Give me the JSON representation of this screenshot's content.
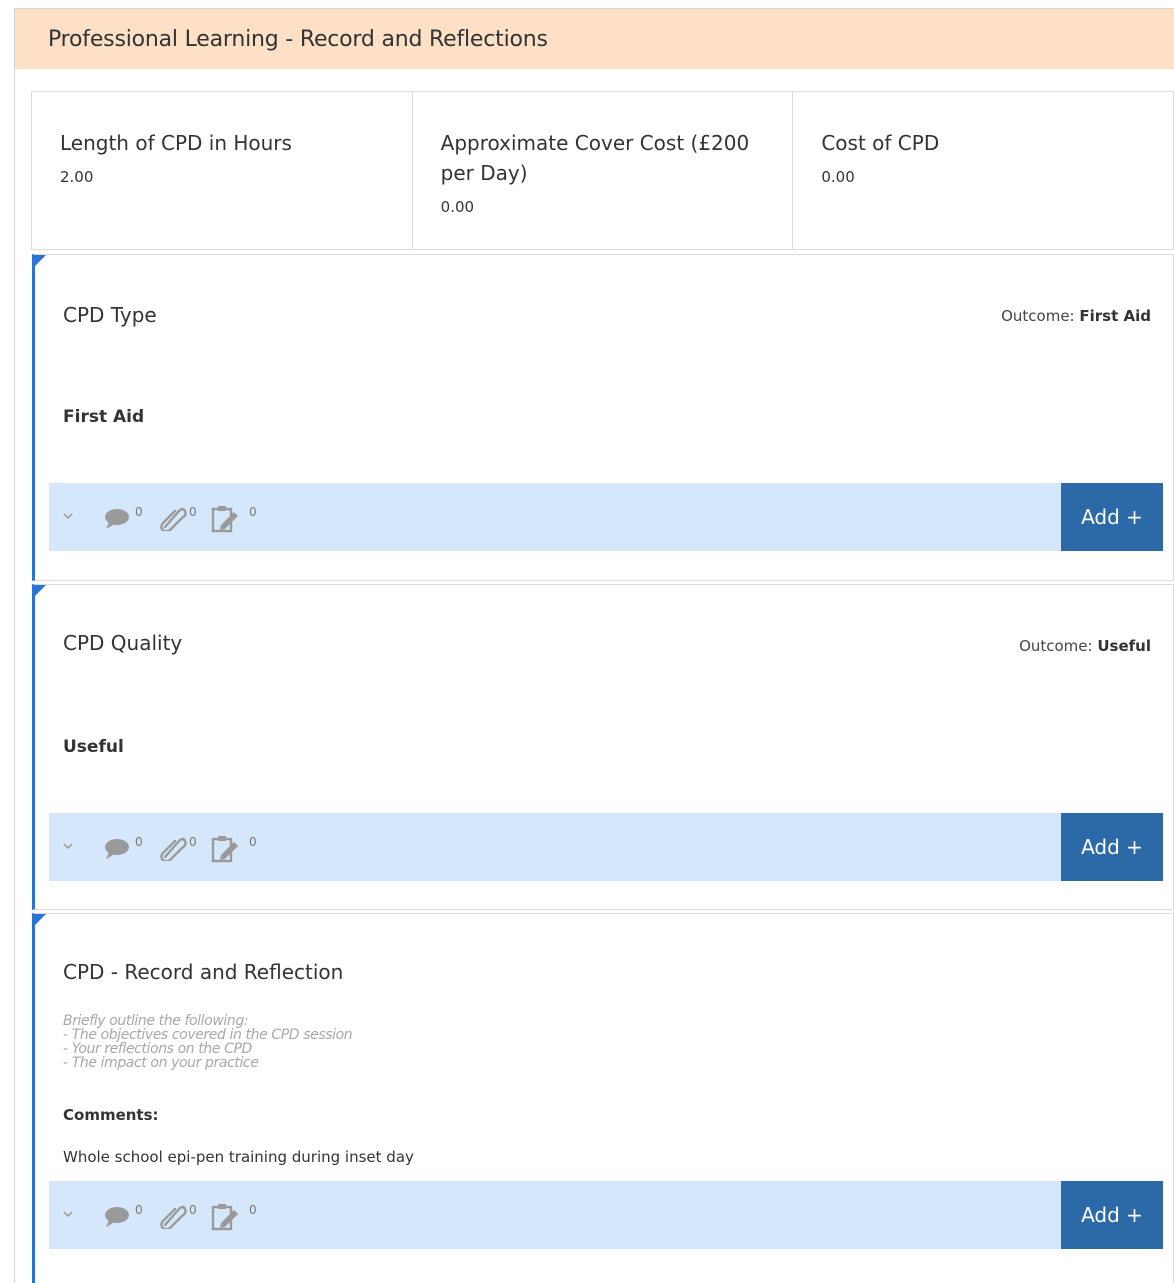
{
  "panel": {
    "title": "Professional Learning - Record and Reflections"
  },
  "stats": [
    {
      "label": "Length of CPD in Hours",
      "value": "2.00"
    },
    {
      "label": "Approximate Cover Cost (£200 per Day)",
      "value": "0.00"
    },
    {
      "label": "Cost of CPD",
      "value": "0.00"
    }
  ],
  "cards": [
    {
      "title": "CPD Type",
      "outcome_label": "Outcome:",
      "outcome_value": "First Aid",
      "answer": "First Aid",
      "comments_count": "0",
      "attachments_count": "0",
      "tasks_count": "0",
      "add_label": "Add +"
    },
    {
      "title": "CPD Quality",
      "outcome_label": "Outcome:",
      "outcome_value": "Useful",
      "answer": "Useful",
      "comments_count": "0",
      "attachments_count": "0",
      "tasks_count": "0",
      "add_label": "Add +"
    },
    {
      "title": "CPD - Record and Reflection",
      "hint_lines": [
        "Briefly outline the following:",
        "- The objectives covered in the CPD session",
        "- Your reflections on the CPD",
        "- The impact on your practice"
      ],
      "comments_label": "Comments:",
      "comments_text": "Whole school epi-pen training during inset day",
      "comments_count": "0",
      "attachments_count": "0",
      "tasks_count": "0",
      "add_label": "Add +"
    }
  ],
  "colors": {
    "header_bg": "#fde0c5",
    "accent_blue": "#2a72d4",
    "toolbar_bg": "#d5e8fb",
    "button_bg": "#2b6aa6"
  },
  "icons": [
    "chevron-down-icon",
    "comment-icon",
    "paperclip-icon",
    "task-edit-icon"
  ]
}
